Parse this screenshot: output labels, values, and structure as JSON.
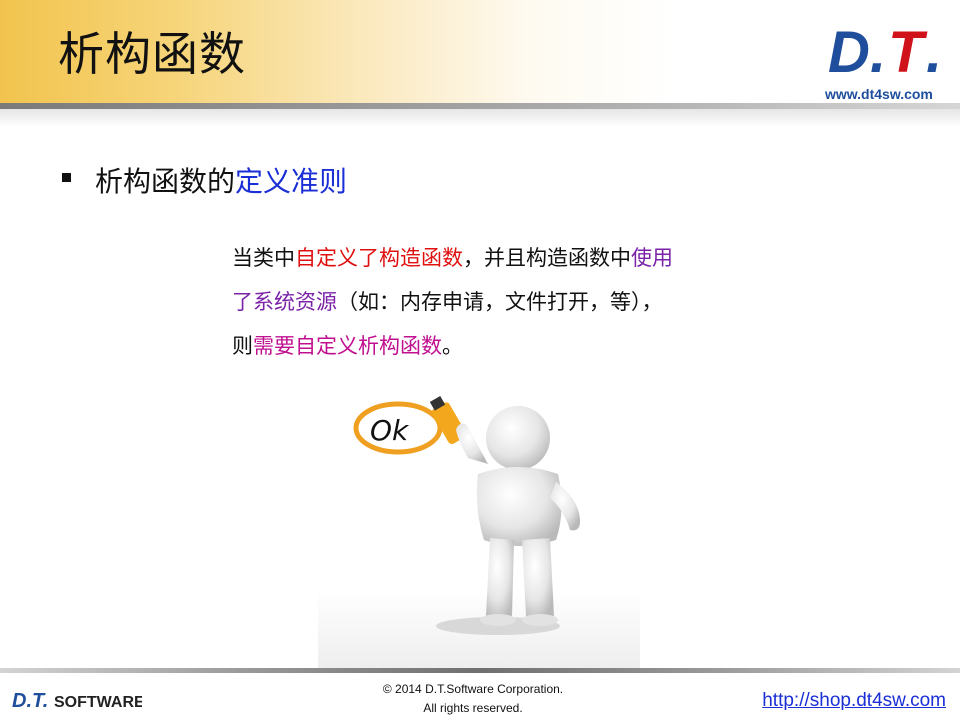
{
  "header": {
    "title": "析构函数",
    "logo_text": "D.T.",
    "site": "www.dt4sw.com"
  },
  "bullet": {
    "prefix": "析构函数的",
    "highlight": "定义准则"
  },
  "paragraph": {
    "segments": [
      "当类中",
      "自定义了构造函数",
      "，并且构造函数中",
      "使用",
      "了系统资源",
      "（如：内存申请，文件打开，等），",
      "则",
      "需要自定义析构函数",
      "。"
    ]
  },
  "figure": {
    "sign_text": "Ok"
  },
  "footer": {
    "logo_mark": "D.T.",
    "logo_word": "SOFTWARE",
    "copyright": "© 2014 D.T.Software Corporation.",
    "rights": "All rights reserved.",
    "shop_link": "http://shop.dt4sw.com"
  },
  "colors": {
    "title_bar_gold": "#f2c44e",
    "accent_blue": "#1a2fd6",
    "red": "#e01010",
    "purple": "#7a22a8",
    "magenta": "#c01090",
    "logo_blue": "#1f4e9c",
    "logo_red": "#d0121b"
  }
}
